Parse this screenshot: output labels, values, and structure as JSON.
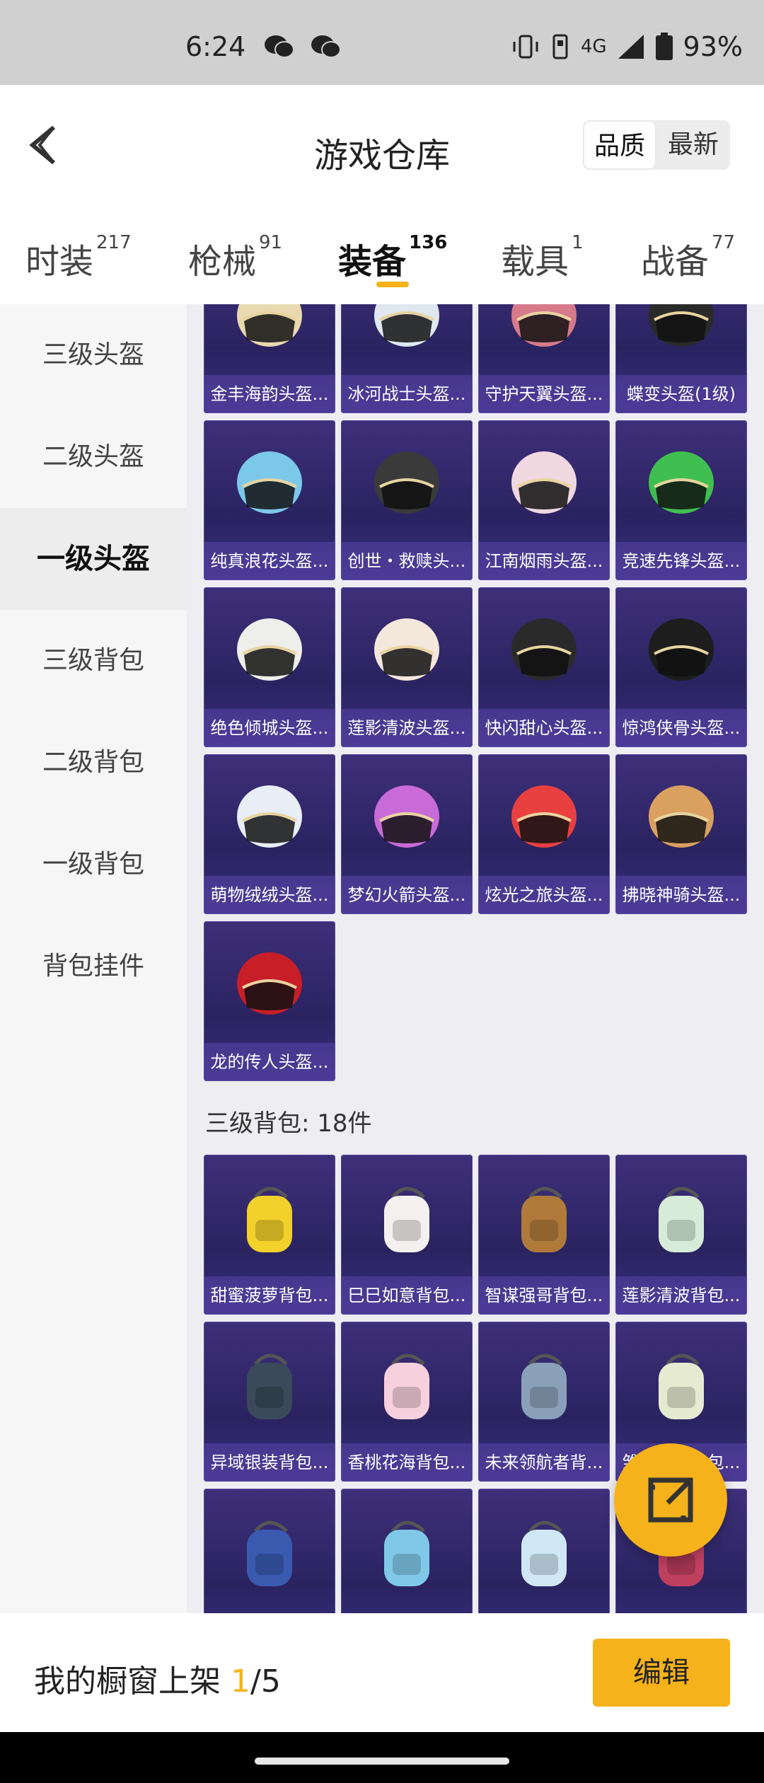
{
  "status_bar": {
    "time": "6:24",
    "network": "4G",
    "battery": "93%"
  },
  "header": {
    "title": "游戏仓库",
    "sort_options": [
      "品质",
      "最新"
    ],
    "active_sort": "品质"
  },
  "tabs": [
    {
      "label": "时装",
      "count": "217"
    },
    {
      "label": "枪械",
      "count": "91"
    },
    {
      "label": "装备",
      "count": "136"
    },
    {
      "label": "载具",
      "count": "1"
    },
    {
      "label": "战备",
      "count": "77"
    }
  ],
  "sidebar": {
    "items": [
      "三级头盔",
      "二级头盔",
      "一级头盔",
      "三级背包",
      "二级背包",
      "一级背包",
      "背包挂件"
    ],
    "active": "一级头盔"
  },
  "helmets": [
    "金丰海韵头盔...",
    "冰河战士头盔...",
    "守护天翼头盔...",
    "蝶变头盔(1级)",
    "纯真浪花头盔...",
    "创世・救赎头...",
    "江南烟雨头盔...",
    "竞速先锋头盔...",
    "绝色倾城头盔...",
    "莲影清波头盔...",
    "快闪甜心头盔...",
    "惊鸿侠骨头盔...",
    "萌物绒绒头盔...",
    "梦幻火箭头盔...",
    "炫光之旅头盔...",
    "拂晓神骑头盔...",
    "龙的传人头盔..."
  ],
  "backpack_section_title": "三级背包: 18件",
  "backpacks": [
    "甜蜜菠萝背包...",
    "巳巳如意背包...",
    "智谋强哥背包...",
    "莲影清波背包...",
    "异域银装背包...",
    "香桃花海背包...",
    "未来领航者背...",
    "雏菊兔兔背包...",
    "",
    "",
    "",
    ""
  ],
  "bottom_bar": {
    "label": "我的橱窗上架 ",
    "current": "1",
    "total": "/5",
    "edit_label": "编辑"
  },
  "colors": {
    "accent": "#f5b21a",
    "card_bg": "#2a2360"
  }
}
